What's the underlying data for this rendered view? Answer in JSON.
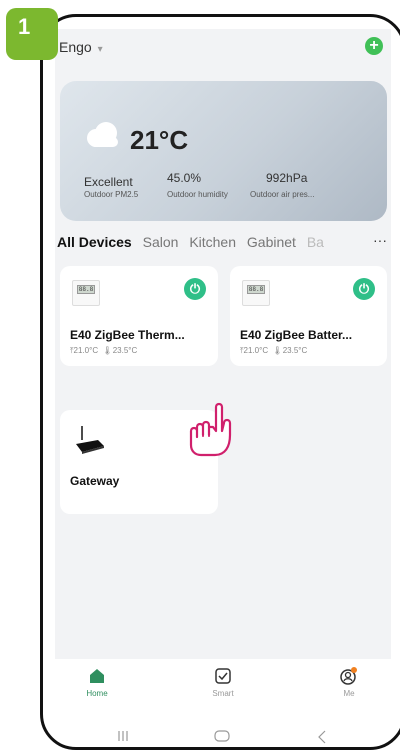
{
  "step": {
    "number": "1"
  },
  "header": {
    "home_name": "Engo",
    "caret": "▾",
    "add_label": "+"
  },
  "weather": {
    "temperature": "21°C",
    "stats": [
      {
        "value": "Excellent",
        "label": "Outdoor PM2.5"
      },
      {
        "value": "45.0%",
        "label": "Outdoor humidity"
      },
      {
        "value": "992hPa",
        "label": "Outdoor air pres..."
      }
    ]
  },
  "tabs": {
    "items": [
      "All Devices",
      "Salon",
      "Kitchen",
      "Gabinet",
      "Ba"
    ],
    "active_index": 0,
    "more_label": "···"
  },
  "devices": [
    {
      "name": "E40 ZigBee Therm...",
      "set_temp": "21.0°C",
      "current_temp": "23.5°C",
      "lcd": "88.8",
      "power_icon": "power-icon"
    },
    {
      "name": "E40 ZigBee Batter...",
      "set_temp": "21.0°C",
      "current_temp": "23.5°C",
      "lcd": "88.8",
      "power_icon": "power-icon"
    }
  ],
  "gateway": {
    "name": "Gateway",
    "icon": "gateway-router-icon"
  },
  "nav": {
    "items": [
      {
        "label": "Home",
        "icon": "home-icon"
      },
      {
        "label": "Smart",
        "icon": "smart-checkbox-icon"
      },
      {
        "label": "Me",
        "icon": "profile-icon"
      }
    ]
  },
  "colors": {
    "step_badge": "#7cb82f",
    "add_button": "#40c057",
    "power_button": "#2fbf88",
    "nav_active": "#2f8f5f",
    "notification_dot": "#f08020"
  }
}
